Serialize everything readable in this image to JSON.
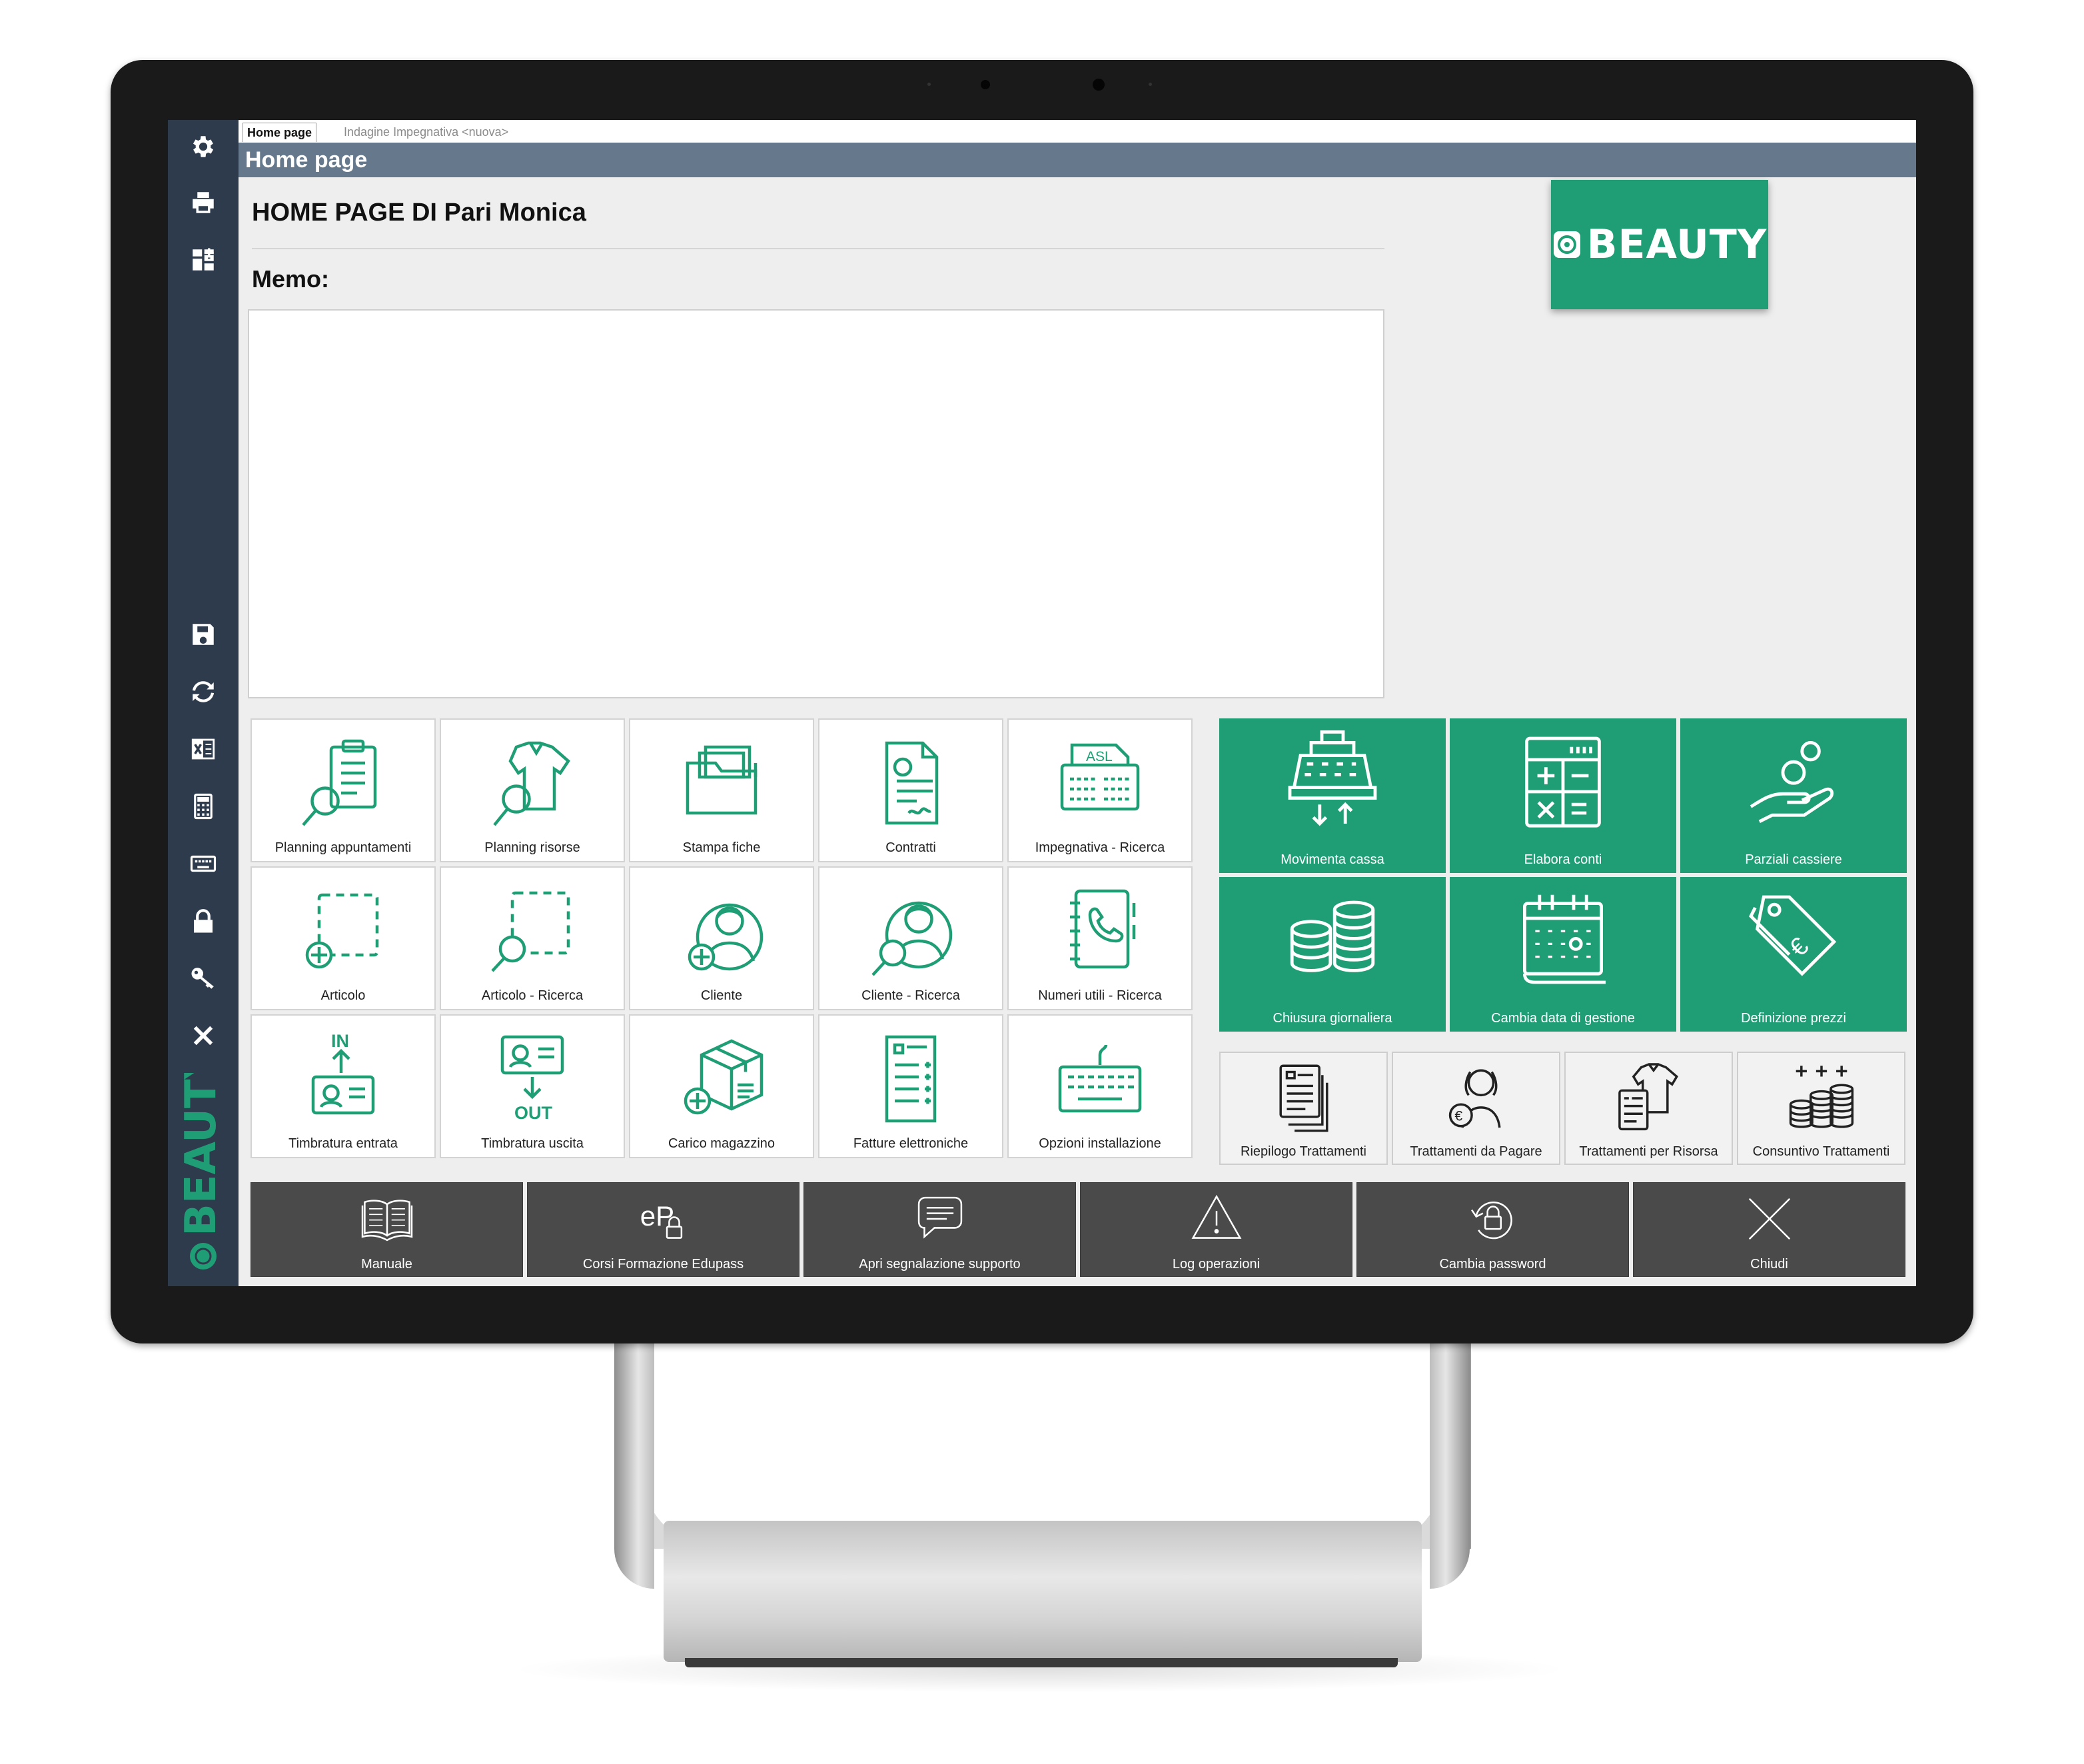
{
  "tabs": [
    {
      "label": "Home page",
      "active": true
    },
    {
      "label": "Indagine Impegnativa <nuova>",
      "active": false
    }
  ],
  "window_title": "Home page",
  "page_title": "HOME PAGE DI Pari Monica",
  "memo_label": "Memo:",
  "memo_value": "",
  "logo_text": "BEAUTY",
  "sidebar_brand": "BEAUTY",
  "sidebar": [
    {
      "icon": "gear-icon"
    },
    {
      "icon": "printer-icon"
    },
    {
      "icon": "dashboard-icon"
    },
    {
      "icon": "save-icon"
    },
    {
      "icon": "refresh-icon"
    },
    {
      "icon": "excel-icon"
    },
    {
      "icon": "calculator-icon"
    },
    {
      "icon": "keyboard-icon"
    },
    {
      "icon": "lock-icon"
    },
    {
      "icon": "key-icon"
    },
    {
      "icon": "close-icon"
    }
  ],
  "tiles_main": [
    {
      "label": "Planning appuntamenti",
      "icon": "clipboard-search-icon"
    },
    {
      "label": "Planning risorse",
      "icon": "shirt-search-icon"
    },
    {
      "label": "Stampa fiche",
      "icon": "folder-icon"
    },
    {
      "label": "Contratti",
      "icon": "contract-icon"
    },
    {
      "label": "Impegnativa - Ricerca",
      "icon": "asl-document-icon"
    },
    {
      "label": "Articolo",
      "icon": "article-add-icon"
    },
    {
      "label": "Articolo - Ricerca",
      "icon": "article-search-icon"
    },
    {
      "label": "Cliente",
      "icon": "client-add-icon"
    },
    {
      "label": "Cliente - Ricerca",
      "icon": "client-search-icon"
    },
    {
      "label": "Numeri utili - Ricerca",
      "icon": "phonebook-icon"
    },
    {
      "label": "Timbratura entrata",
      "icon": "badge-in-icon"
    },
    {
      "label": "Timbratura uscita",
      "icon": "badge-out-icon"
    },
    {
      "label": "Carico magazzino",
      "icon": "box-add-icon"
    },
    {
      "label": "Fatture elettroniche",
      "icon": "invoice-icon"
    },
    {
      "label": "Opzioni installazione",
      "icon": "keyboard-icon"
    }
  ],
  "tiles_cash": [
    {
      "label": "Movimenta cassa",
      "icon": "cash-register-icon"
    },
    {
      "label": "Elabora conti",
      "icon": "calculator-icon"
    },
    {
      "label": "Parziali cassiere",
      "icon": "hand-coin-icon"
    },
    {
      "label": "Chiusura giornaliera",
      "icon": "coin-stacks-icon"
    },
    {
      "label": "Cambia data di gestione",
      "icon": "calendar-icon"
    },
    {
      "label": "Definizione prezzi",
      "icon": "price-tag-icon"
    }
  ],
  "tiles_reports": [
    {
      "label": "Riepilogo Trattamenti",
      "icon": "documents-icon"
    },
    {
      "label": "Trattamenti da Pagare",
      "icon": "person-euro-icon"
    },
    {
      "label": "Trattamenti per Risorsa",
      "icon": "shirt-document-icon"
    },
    {
      "label": "Consuntivo Trattamenti",
      "icon": "coins-plus-icon"
    }
  ],
  "bottom_actions": [
    {
      "label": "Manuale",
      "icon": "book-icon"
    },
    {
      "label": "Corsi Formazione Edupass",
      "icon": "edupass-icon",
      "icon_text": "eP"
    },
    {
      "label": "Apri segnalazione supporto",
      "icon": "chat-icon"
    },
    {
      "label": "Log operazioni",
      "icon": "warning-icon"
    },
    {
      "label": "Cambia password",
      "icon": "lock-refresh-icon"
    },
    {
      "label": "Chiudi",
      "icon": "close-icon"
    }
  ],
  "colors": {
    "accent_green": "#1f9e76",
    "sidebar_bg": "#2d3b4d",
    "titlebar_bg": "#66788c",
    "action_bar_bg": "#4a4a4a"
  }
}
